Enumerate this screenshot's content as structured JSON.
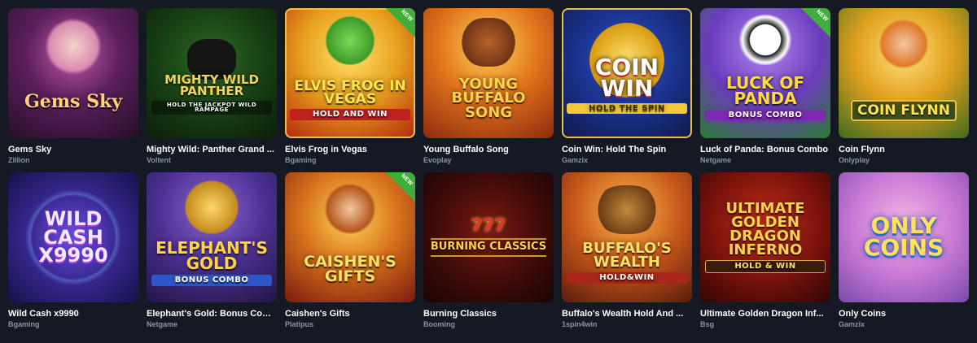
{
  "games": [
    {
      "name": "Gems Sky",
      "provider": "Zillion",
      "art": "Gems Sky",
      "sub": ""
    },
    {
      "name": "Mighty Wild: Panther Grand ...",
      "provider": "Voltent",
      "art": "Mighty Wild Panther",
      "sub": "Hold the Jackpot Wild Rampage"
    },
    {
      "name": "Elvis Frog in Vegas",
      "provider": "Bgaming",
      "art": "Elvis Frog in Vegas",
      "sub": "Hold and Win",
      "badge": "NEW"
    },
    {
      "name": "Young Buffalo Song",
      "provider": "Evoplay",
      "art": "Young Buffalo Song",
      "sub": ""
    },
    {
      "name": "Coin Win: Hold The Spin",
      "provider": "Gamzix",
      "art": "Coin Win",
      "sub": "Hold the Spin"
    },
    {
      "name": "Luck of Panda: Bonus Combo",
      "provider": "Netgame",
      "art": "Luck of Panda",
      "sub": "Bonus Combo",
      "badge": "NEW"
    },
    {
      "name": "Coin Flynn",
      "provider": "Onlyplay",
      "art": "Coin Flynn",
      "sub": ""
    },
    {
      "name": "Wild Cash x9990",
      "provider": "Bgaming",
      "art": "Wild Cash x9990",
      "sub": ""
    },
    {
      "name": "Elephant's Gold: Bonus Com...",
      "provider": "Netgame",
      "art": "Elephant's Gold",
      "sub": "Bonus Combo"
    },
    {
      "name": "Caishen's Gifts",
      "provider": "Platipus",
      "art": "Caishen's Gifts",
      "sub": "",
      "badge": "NEW"
    },
    {
      "name": "Burning Classics",
      "provider": "Booming",
      "art": "Burning Classics",
      "sub": "777"
    },
    {
      "name": "Buffalo's Wealth Hold And ...",
      "provider": "1spin4win",
      "art": "Buffalo's Wealth",
      "sub": "Hold&Win"
    },
    {
      "name": "Ultimate Golden Dragon Inf...",
      "provider": "Bsg",
      "art": "Ultimate Golden Dragon Inferno",
      "sub": "Hold & Win"
    },
    {
      "name": "Only Coins",
      "provider": "Gamzix",
      "art": "Only Coins",
      "sub": ""
    }
  ],
  "colors": {
    "page_bg": "#141924",
    "provider_text": "#8a93a6",
    "new_badge": "#3fae3a"
  }
}
